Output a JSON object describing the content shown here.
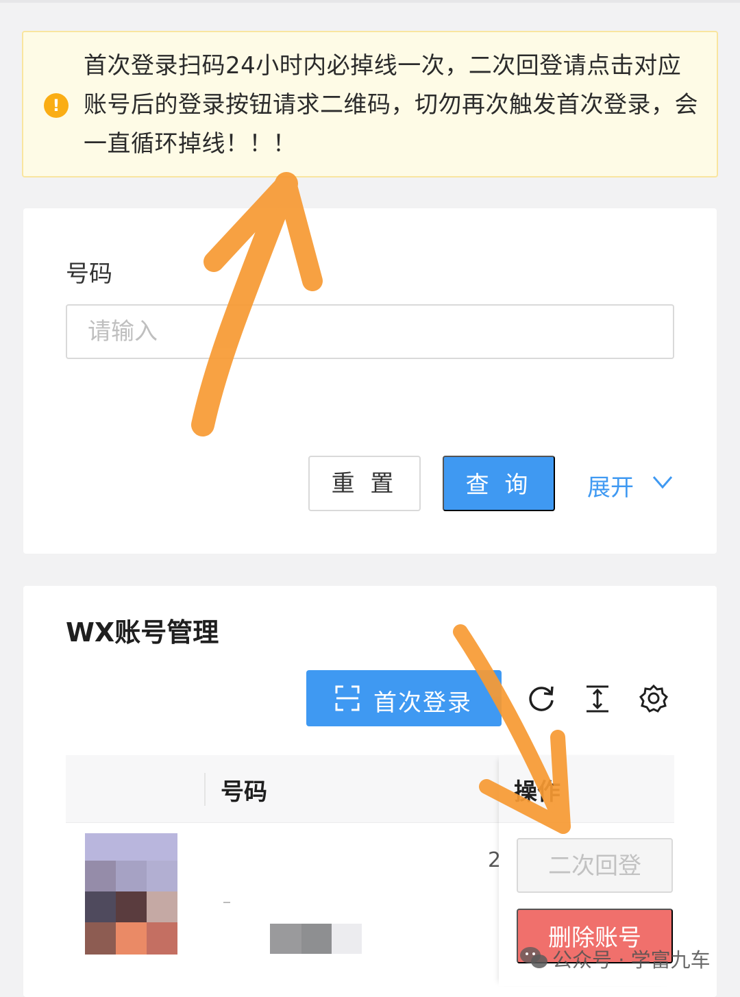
{
  "notice": {
    "text": "首次登录扫码24小时内必掉线一次，二次回登请点击对应账号后的登录按钮请求二维码，切勿再次触发首次登录，会一直循环掉线！！！",
    "icon": "exclamation-circle-icon",
    "icon_glyph": "!",
    "color": "#faad14"
  },
  "search": {
    "field_label": "号码",
    "placeholder": "请输入",
    "value": "",
    "reset_label": "重 置",
    "query_label": "查 询",
    "expand_label": "展开"
  },
  "table_card": {
    "title": "WX账号管理",
    "first_login_label": "首次登录",
    "tools": [
      "refresh-icon",
      "column-height-icon",
      "setting-icon"
    ],
    "columns": [
      "号码",
      "操作"
    ],
    "rows": [
      {
        "partial_text": "2",
        "relogin_label": "二次回登",
        "delete_label": "删除账号"
      }
    ]
  },
  "watermark": {
    "text": "公众号 · 学富九车"
  },
  "colors": {
    "primary": "#3f99f2",
    "danger": "#f0706c",
    "warning": "#faad14",
    "annotation_arrow": "#f79a33"
  }
}
